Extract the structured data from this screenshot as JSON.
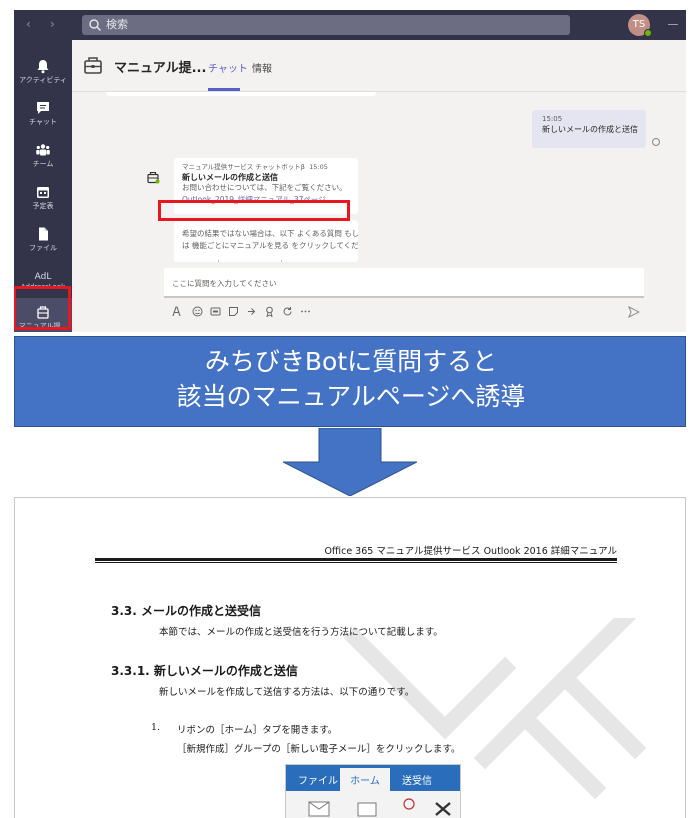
{
  "teams": {
    "search_placeholder": "検索",
    "user_initials": "TS",
    "rail": [
      {
        "label": "アクティビティ"
      },
      {
        "label": "チャット"
      },
      {
        "label": "チーム"
      },
      {
        "label": "予定表"
      },
      {
        "label": "ファイル"
      },
      {
        "label_top": "AdL",
        "label": "AddressLook"
      },
      {
        "label": "マニュアル提..."
      }
    ],
    "chat_title": "マニュアル提...",
    "tabs": {
      "chat": "チャット",
      "info": "情報"
    },
    "my_message": {
      "time": "15:05",
      "text": "新しいメールの作成と送信"
    },
    "bot_message": {
      "sender": "マニュアル提供サービス チャットボットβ",
      "time": "15:05",
      "title": "新しいメールの作成と送信",
      "intro": "お問い合わせについては、下記をご覧ください。",
      "link": "Outlook_2019_詳細マニュアル_37ページ"
    },
    "bot_message2": {
      "line1": "希望の結果ではない場合は、以下 よくある質問 もしく",
      "line2": "は 機能ごとにマニュアルを見る をクリックしてください。"
    },
    "compose_placeholder": "ここに質問を入力してください"
  },
  "banner": {
    "line1": "みちびきBotに質問すると",
    "line2": "該当のマニュアルページへ誘導"
  },
  "manual": {
    "running_header": "Office 365 マニュアル提供サービス Outlook 2016 詳細マニュアル",
    "section_heading": "3.3.  メールの作成と送受信",
    "section_text": "本節では、メールの作成と送受信を行う方法について記載します。",
    "subsection_heading": "3.3.1.   新しいメールの作成と送信",
    "subsection_text": "新しいメールを作成して送信する方法は、以下の通りです。",
    "step_number": "1.",
    "step_line1": "リボンの［ホーム］タブを開きます。",
    "step_line2": "［新規作成］グループの［新しい電子メール］をクリックします。",
    "ribbon_tabs": {
      "file": "ファイル",
      "home": "ホーム",
      "send": "送受信"
    },
    "watermark": "LE"
  },
  "colors": {
    "teams_dark": "#33344a",
    "teams_accent": "#5b5fc7",
    "highlight_red": "#e8161f",
    "banner_blue": "#4472c4",
    "office_blue": "#2a6ebb"
  }
}
